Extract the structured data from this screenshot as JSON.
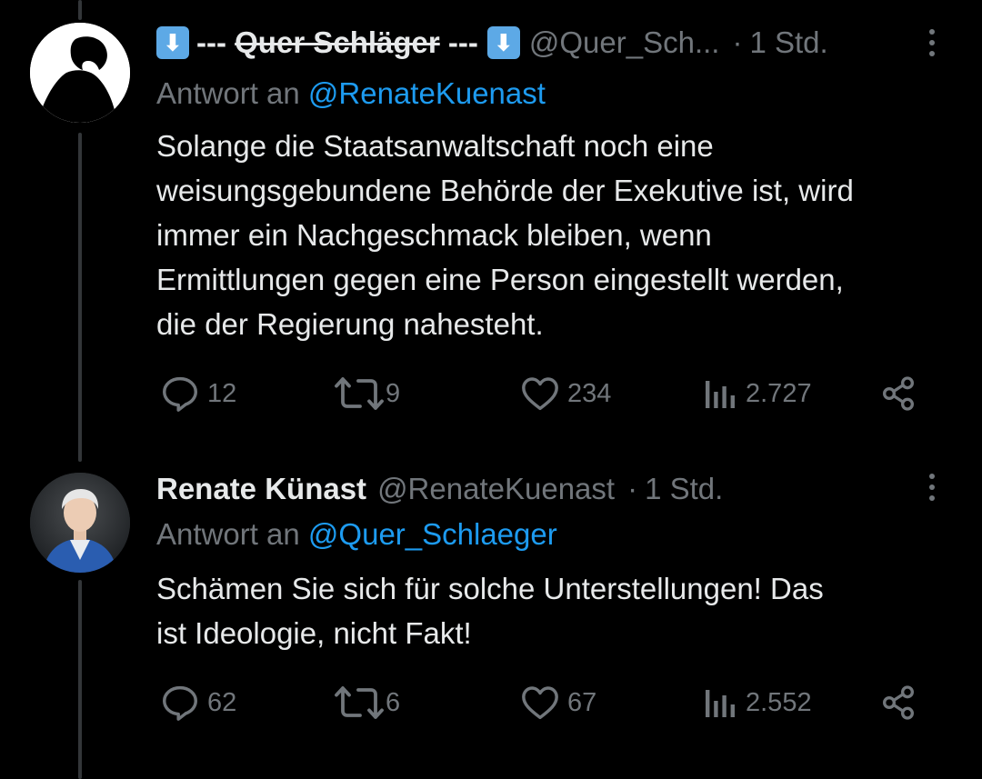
{
  "tweets": [
    {
      "author_prefix_icon": "down-arrow-emoji",
      "author_name_prefix": "--- ",
      "author_name_struck": "Quer Schläger",
      "author_name_suffix": " ---",
      "author_suffix_icon": "down-arrow-emoji",
      "handle": "@Quer_Sch...",
      "dot": "·",
      "time": "1 Std.",
      "reply_prefix": "Antwort an ",
      "reply_mention": "@RenateKuenast",
      "text_lines": [
        "Solange die Staatsanwaltschaft noch eine",
        "weisungsgebundene Behörde der Exekutive ist, wird",
        "immer ein Nachgeschmack bleiben, wenn",
        "Ermittlungen gegen eine Person eingestellt werden,",
        "die der Regierung nahesteht."
      ],
      "replies": "12",
      "reposts": "9",
      "likes": "234",
      "views": "2.727"
    },
    {
      "author_name": "Renate Künast",
      "handle": "@RenateKuenast",
      "dot": "·",
      "time": "1 Std.",
      "reply_prefix": "Antwort an ",
      "reply_mention": "@Quer_Schlaeger",
      "text_lines": [
        "Schämen Sie sich für solche Unterstellungen! Das",
        "ist Ideologie, nicht Fakt!"
      ],
      "replies": "62",
      "reposts": "6",
      "likes": "67",
      "views": "2.552"
    }
  ],
  "colors": {
    "background": "#000000",
    "text": "#e7e9ea",
    "muted": "#71767b",
    "link": "#1d9bf0",
    "thread_line": "#333639"
  }
}
